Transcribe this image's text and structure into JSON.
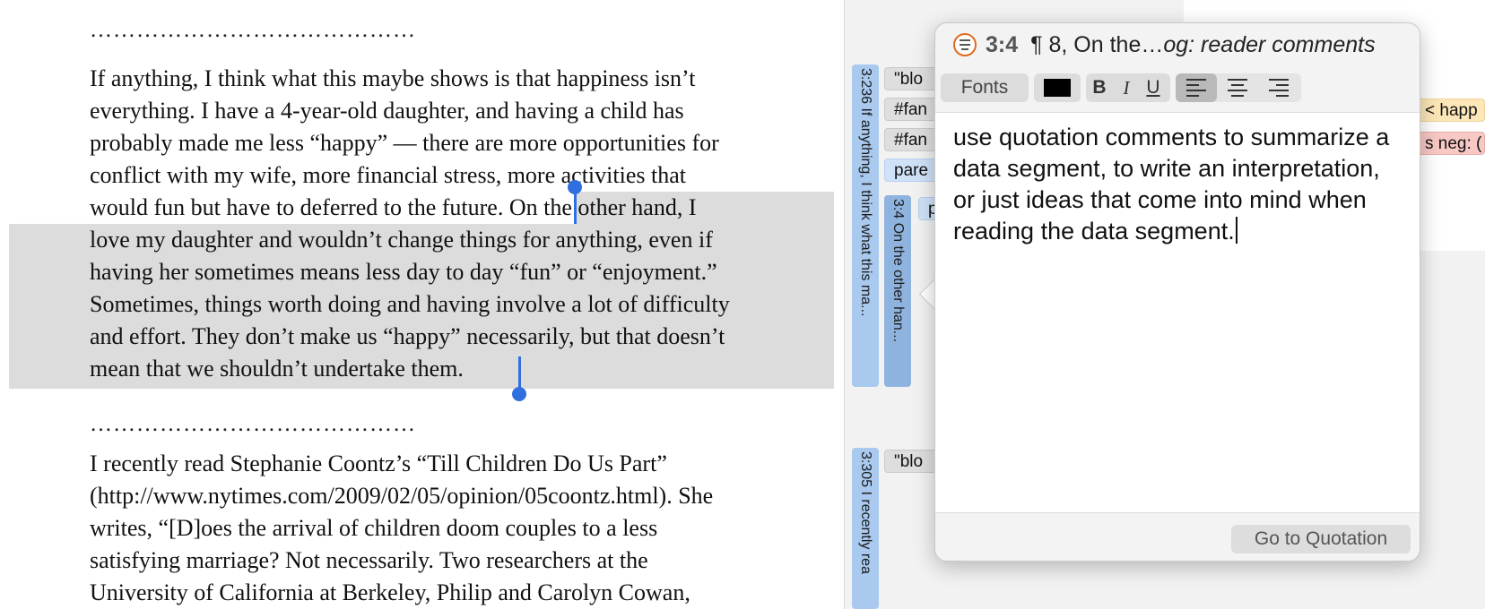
{
  "document": {
    "separator": "……………………………………",
    "paragraph1_lines": [
      "If anything, I think what this maybe shows is that happiness isn’t",
      "everything. I have a 4-year-old daughter, and having a child has",
      "probably made me less “happy” — there are more opportunities for",
      "conflict with my wife, more financial stress, more activities that",
      "would fun but have to deferred to the future. On the other hand, I",
      "love my daughter and wouldn’t change things for anything, even if",
      "having her sometimes means less day to day “fun” or “enjoyment.”",
      "Sometimes, things worth doing and having involve a lot of difficulty",
      "and effort. They don’t make us “happy” necessarily, but that doesn’t",
      "mean that we shouldn’t undertake them."
    ],
    "paragraph2_lines": [
      "I recently read Stephanie Coontz’s “Till Children Do Us Part”",
      "(http://www.nytimes.com/2009/02/05/opinion/05coontz.html). She",
      "writes, “[D]oes the arrival of children doom couples to a less",
      "satisfying marriage? Not necessarily. Two researchers at the",
      "University of California at Berkeley, Philip and Carolyn Cowan,"
    ]
  },
  "margin": {
    "quote1_label": "3:236 If anything, I think what this ma...",
    "quote2_label": "3:4 On the other han...",
    "quote3_label": "3:305 I recently rea",
    "codes": [
      {
        "text": "\"blo",
        "style": "gray"
      },
      {
        "text": "#fan",
        "style": "gray"
      },
      {
        "text": "#fan",
        "style": "gray"
      },
      {
        "text": "pare",
        "style": "blue"
      },
      {
        "text": "p",
        "style": "blue"
      },
      {
        "text": "\"blo",
        "style": "gray"
      },
      {
        "text": "< happ",
        "style": "yellow"
      },
      {
        "text": "s neg: (",
        "style": "pink"
      }
    ]
  },
  "popover": {
    "quote_id": "3:4",
    "quote_ref": "¶ 8, On the…",
    "doc_name": "og: reader comments",
    "toolbar": {
      "fonts_label": "Fonts",
      "color": "#000000",
      "bold_label": "B",
      "italic_label": "I",
      "underline_label": "U"
    },
    "comment_text": "use quotation comments to summarize a data segment, to write an interpretation, or just ideas that come into mind when reading the data segment.",
    "goto_label": "Go to Quotation"
  }
}
